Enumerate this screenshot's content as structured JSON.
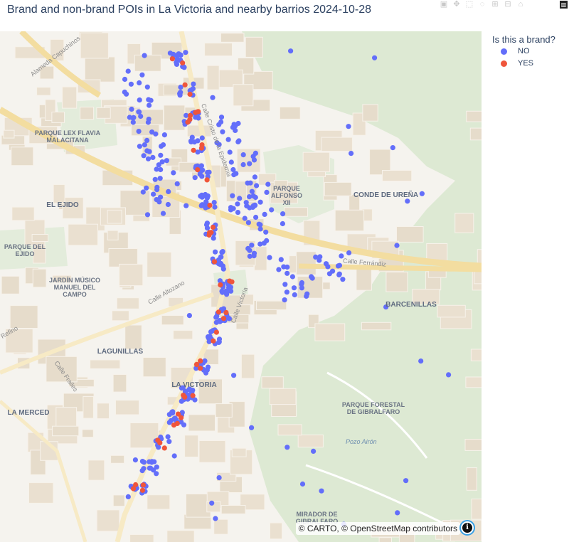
{
  "title": "Brand and non-brand POIs in La Victoria and nearby barrios 2024-10-28",
  "modebar": {
    "icons": [
      "camera-icon",
      "pan-icon",
      "select-box-icon",
      "lasso-icon",
      "zoom-in-icon",
      "zoom-out-icon",
      "home-icon",
      "plotly-logo-icon"
    ]
  },
  "legend": {
    "title": "Is this a brand?",
    "items": [
      {
        "label": "NO",
        "color": "#636efa"
      },
      {
        "label": "YES",
        "color": "#ef553b"
      }
    ]
  },
  "map": {
    "attribution": "© CARTO, © OpenStreetMap contributors",
    "areas": [
      "Parque Lex Flavia Malacitana",
      "El Ejido",
      "Parque del Ejido",
      "Jardín Músico Manuel del Campo",
      "Parque Alfonso XII",
      "Conde de Ureña",
      "Barcenillas",
      "Lagunillas",
      "La Victoria",
      "La Merced",
      "Parque Forestal de Gibralfaro",
      "Mirador de Gibralfaro"
    ],
    "streets": [
      "Alameda Capuchinos",
      "Calle Cristo de la Epidemia",
      "Calle Ferrándiz",
      "Calle Altozano",
      "Calle Victoria",
      "Calle Frailes",
      "Refino"
    ],
    "water": [
      "Pozo Airón"
    ]
  },
  "chart_data": {
    "type": "scatter",
    "title": "Brand and non-brand POIs in La Victoria and nearby barrios 2024-10-28",
    "legend_title": "Is this a brand?",
    "legend_placement": "top-right",
    "series": [
      {
        "name": "NO",
        "color": "#636efa",
        "count": 410
      },
      {
        "name": "YES",
        "color": "#ef553b",
        "count": 45
      }
    ]
  }
}
